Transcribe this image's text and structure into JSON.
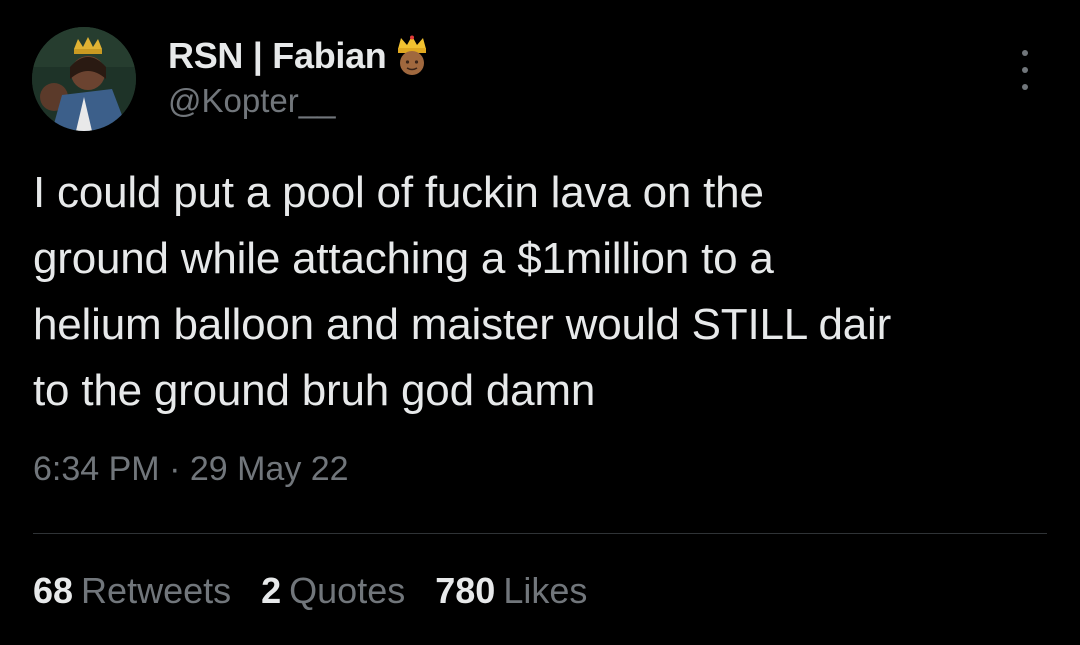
{
  "author": {
    "display_name": "RSN | Fabian",
    "name_emoji_icon": "crown-person-icon",
    "handle": "@Kopter__"
  },
  "tweet": {
    "text": "I could put a pool of fuckin lava on the\nground while attaching a $1million to a\nhelium balloon and maister would STILL dair\nto the ground bruh god damn",
    "timestamp": "6:34 PM · 29 May 22"
  },
  "stats": {
    "retweets": {
      "count": "68",
      "label": "Retweets"
    },
    "quotes": {
      "count": "2",
      "label": "Quotes"
    },
    "likes": {
      "count": "780",
      "label": "Likes"
    }
  },
  "colors": {
    "background": "#000000",
    "primary_text": "#e7e9ea",
    "secondary_text": "#71767b",
    "divider": "#2f3336"
  }
}
